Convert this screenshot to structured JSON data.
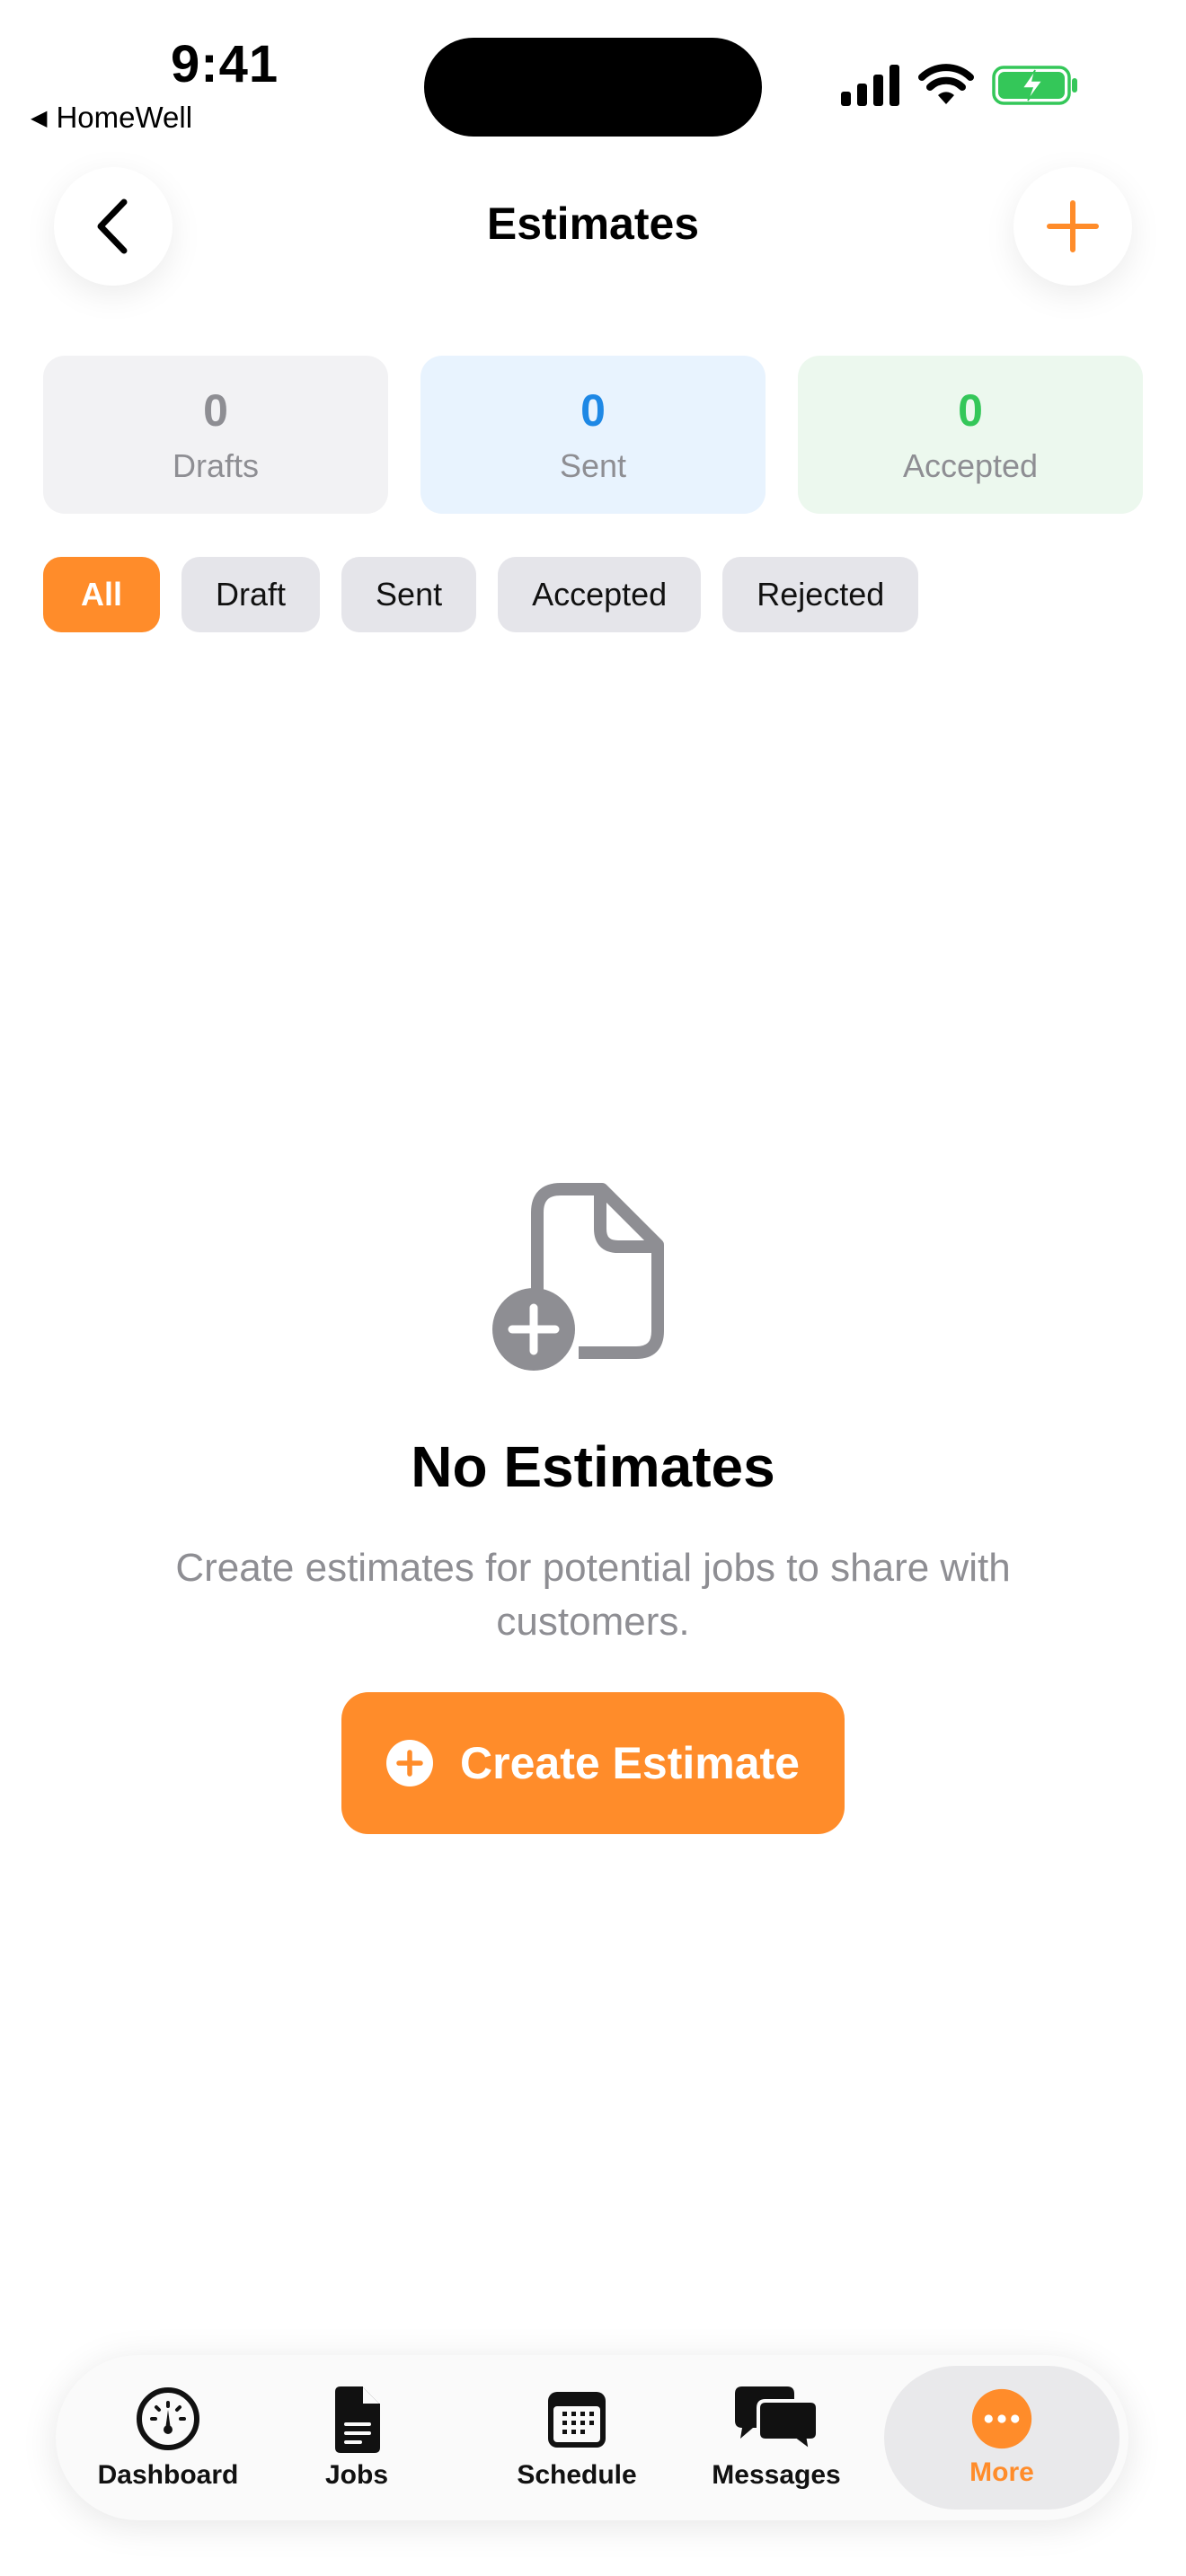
{
  "status_bar": {
    "time": "9:41",
    "back_app": "HomeWell",
    "back_arrow": "◀"
  },
  "header": {
    "title": "Estimates",
    "back_icon": "chevron-left-icon",
    "add_icon": "plus-icon"
  },
  "stats": [
    {
      "value": "0",
      "label": "Drafts"
    },
    {
      "value": "0",
      "label": "Sent"
    },
    {
      "value": "0",
      "label": "Accepted"
    }
  ],
  "filters": [
    {
      "label": "All",
      "selected": true
    },
    {
      "label": "Draft",
      "selected": false
    },
    {
      "label": "Sent",
      "selected": false
    },
    {
      "label": "Accepted",
      "selected": false
    },
    {
      "label": "Rejected",
      "selected": false
    }
  ],
  "empty_state": {
    "icon": "document-add-icon",
    "title": "No Estimates",
    "description": "Create estimates for potential jobs to share with customers.",
    "button_label": "Create Estimate"
  },
  "tab_bar": {
    "items": [
      {
        "label": "Dashboard",
        "icon": "gauge-icon"
      },
      {
        "label": "Jobs",
        "icon": "document-icon"
      },
      {
        "label": "Schedule",
        "icon": "calendar-icon"
      },
      {
        "label": "Messages",
        "icon": "chat-bubbles-icon"
      },
      {
        "label": "More",
        "icon": "ellipsis-circle-icon",
        "selected": true
      }
    ]
  },
  "colors": {
    "accent": "#ff8c2a",
    "sent": "#1e88e5",
    "accepted": "#34c759",
    "muted": "#8e8e93"
  }
}
